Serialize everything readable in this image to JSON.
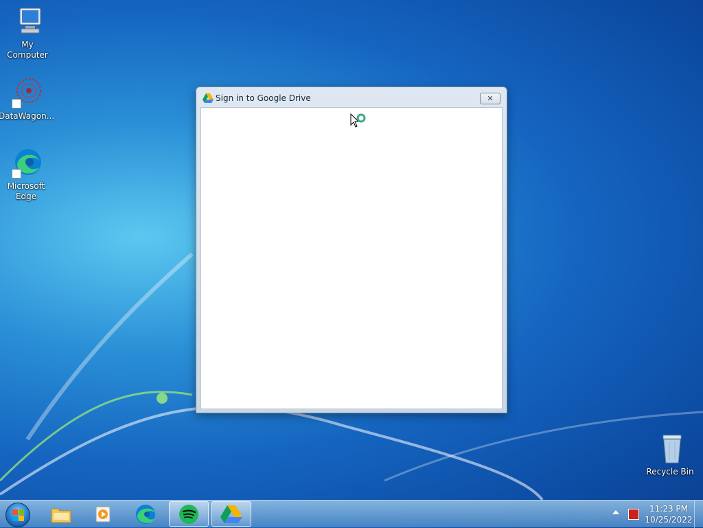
{
  "desktop": {
    "icons": [
      {
        "label": "My Computer",
        "icon": "my-computer-icon"
      },
      {
        "label": "DataWagon...",
        "icon": "datawagon-icon",
        "shortcut": true
      },
      {
        "label": "Microsoft Edge",
        "icon": "edge-icon",
        "shortcut": true
      },
      {
        "label": "Recycle Bin",
        "icon": "recycle-bin-icon"
      }
    ]
  },
  "dialog": {
    "title": "Sign in to Google Drive",
    "close_symbol": "✕"
  },
  "taskbar": {
    "pinned": [
      {
        "name": "windows-explorer",
        "icon": "folder-icon",
        "active": false
      },
      {
        "name": "media-player",
        "icon": "media-player-icon",
        "active": false
      },
      {
        "name": "microsoft-edge",
        "icon": "edge-icon",
        "active": false
      },
      {
        "name": "spotify",
        "icon": "spotify-icon",
        "active": true
      },
      {
        "name": "google-drive",
        "icon": "google-drive-icon",
        "active": true
      }
    ],
    "clock": {
      "time": "11:23 PM",
      "date": "10/25/2022"
    }
  },
  "colors": {
    "accent": "#1565c0",
    "spotify": "#1db954",
    "drive_blue": "#4285f4",
    "drive_green": "#0f9d58",
    "drive_yellow": "#f4b400"
  }
}
